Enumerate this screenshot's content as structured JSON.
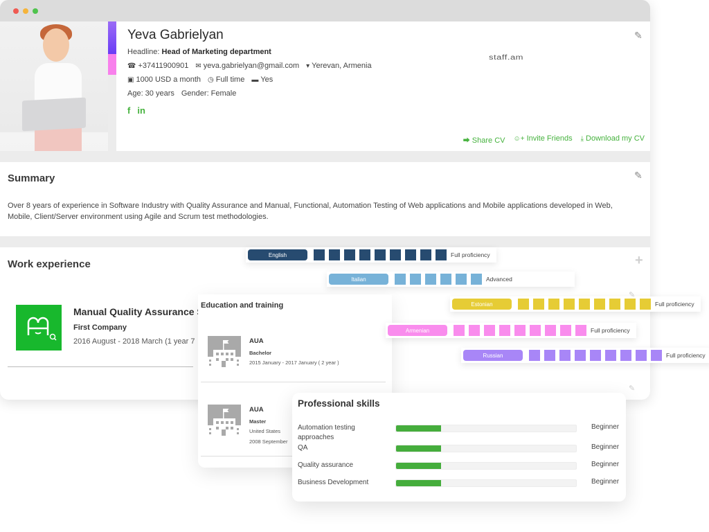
{
  "profile": {
    "name": "Yeva Gabrielyan",
    "headline_label": "Headline:",
    "headline": "Head of Marketing department",
    "phone": "+37411900901",
    "email": "yeva.gabrielyan@gmail.com",
    "location": "Yerevan, Armenia",
    "salary": "1000 USD a month",
    "employment": "Full time",
    "car": "Yes",
    "age": "Age: 30 years",
    "gender": "Gender: Female",
    "brand": "staff.am",
    "social": [
      "f",
      "in"
    ],
    "actions": {
      "share": "Share CV",
      "invite": "Invite Friends",
      "download": "Download my CV"
    },
    "icons": {
      "phone": "phone-icon",
      "email": "envelope-icon",
      "location": "map-marker-icon",
      "salary": "money-icon",
      "employment": "clock-icon",
      "car": "car-icon",
      "edit": "pencil-icon",
      "share": "share-icon",
      "invite": "user-plus-icon",
      "download": "download-icon"
    },
    "accent_colors": [
      "#7b4cf5",
      "#f880ec"
    ]
  },
  "summary": {
    "title": "Summary",
    "text": "Over 8 years of experience in Software Industry with Quality Assurance and Manual, Functional, Automation Testing of Web applications and Mobile applications developed in Web, Mobile, Client/Server environment using Agile and Scrum test methodologies."
  },
  "work": {
    "title": "Work experience",
    "job_title": "Manual Quality Assurance S",
    "company": "First Company",
    "dates": "2016 August - 2018 March (1 year 7"
  },
  "education": {
    "title": "Education and training",
    "items": [
      {
        "name": "AUA",
        "degree": "Bachelor",
        "dates": "2015 January - 2017 January ( 2 year )"
      },
      {
        "name": "AUA",
        "degree": "Master",
        "country": "United States",
        "dates": "2008 September"
      }
    ]
  },
  "skills": {
    "title": "Professional skills",
    "accent": "#45ad3c",
    "items": [
      {
        "name": "Automation testing approaches",
        "level": "Beginner",
        "progress": 0.25
      },
      {
        "name": "QA",
        "level": "Beginner",
        "progress": 0.25
      },
      {
        "name": "Quality assurance",
        "level": "Beginner",
        "progress": 0.25
      },
      {
        "name": "Business Development",
        "level": "Beginner",
        "progress": 0.25
      }
    ]
  },
  "languages": [
    {
      "name": "English",
      "level": "Full proficiency",
      "squares": 9,
      "color": "#274b70"
    },
    {
      "name": "Italian",
      "level": "Advanced",
      "squares": 6,
      "color": "#77b2d8"
    },
    {
      "name": "Estonian",
      "level": "Full proficiency",
      "squares": 9,
      "color": "#e6cc35"
    },
    {
      "name": "Armenian",
      "level": "Full proficiency",
      "squares": 9,
      "color": "#f98ced"
    },
    {
      "name": "Russian",
      "level": "Full proficiency",
      "squares": 9,
      "color": "#a886f7"
    }
  ]
}
